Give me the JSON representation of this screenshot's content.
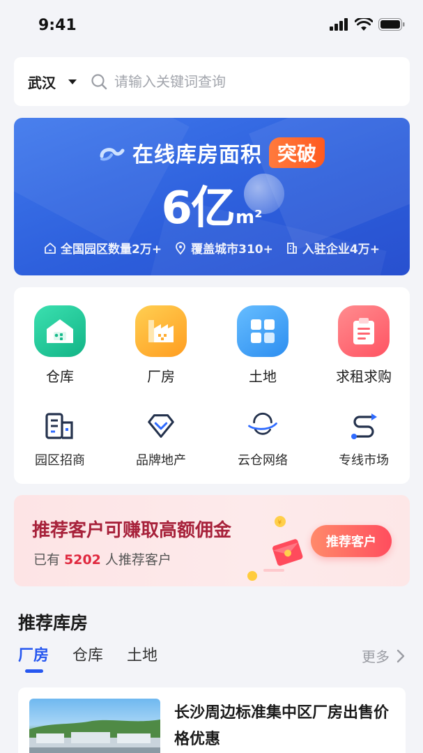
{
  "status_bar": {
    "time": "9:41"
  },
  "search": {
    "city": "武汉",
    "placeholder": "请输入关键词查询"
  },
  "banner": {
    "title": "在线库房面积",
    "badge": "突破",
    "number": "6亿",
    "unit": "m²",
    "stats": [
      {
        "icon": "home-outline-icon",
        "label": "全国园区数量2万+"
      },
      {
        "icon": "location-pin-icon",
        "label": "覆盖城市310+"
      },
      {
        "icon": "building-icon",
        "label": "入驻企业4万+"
      }
    ]
  },
  "categories": [
    {
      "label": "仓库",
      "icon": "warehouse-icon",
      "color": "#22c69a"
    },
    {
      "label": "厂房",
      "icon": "factory-icon",
      "color": "#ffb23a"
    },
    {
      "label": "土地",
      "icon": "land-grid-icon",
      "color": "#3fa0f5"
    },
    {
      "label": "求租求购",
      "icon": "clipboard-icon",
      "color": "#ff6b73"
    }
  ],
  "services": [
    {
      "label": "园区招商",
      "icon": "park-building-icon"
    },
    {
      "label": "品牌地产",
      "icon": "diamond-icon"
    },
    {
      "label": "云仓网络",
      "icon": "cloud-orbit-icon"
    },
    {
      "label": "专线市场",
      "icon": "route-icon"
    }
  ],
  "promo": {
    "title": "推荐客户可赚取高额佣金",
    "sub_prefix": "已有",
    "count": "5202",
    "sub_suffix": "人推荐客户",
    "button": "推荐客户"
  },
  "section": {
    "title": "推荐库房",
    "tabs": [
      "厂房",
      "仓库",
      "土地"
    ],
    "more": "更多"
  },
  "listing": {
    "title": "长沙周边标准集中区厂房出售价格优惠"
  },
  "colors": {
    "accent": "#2657f0",
    "banner": "#2d5fdc",
    "promo_text": "#a7213a",
    "promo_count": "#e0293f"
  }
}
